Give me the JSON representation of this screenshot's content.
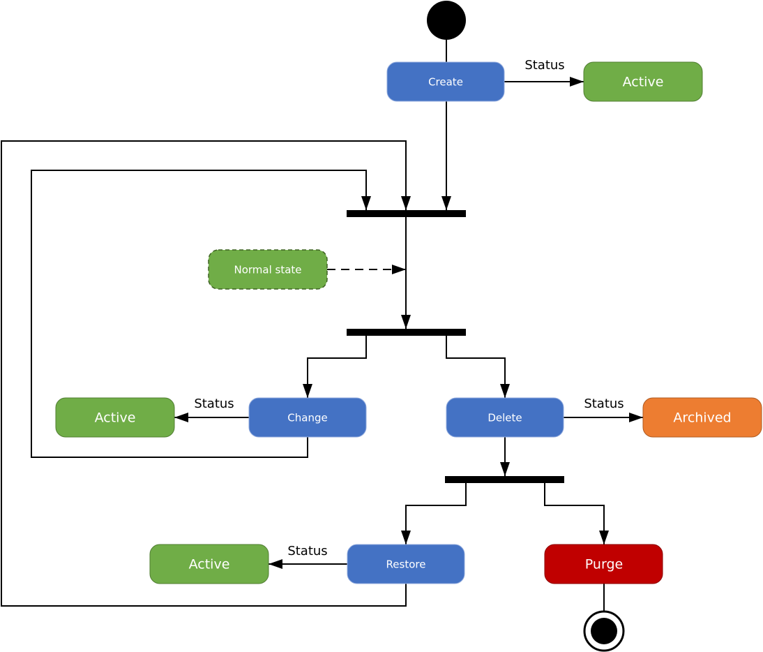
{
  "colors": {
    "action": "#4472C4",
    "active": "#70AD47",
    "archived": "#ED7D31",
    "purge": "#C00000",
    "line": "#000000"
  },
  "nodes": {
    "create": "Create",
    "active_create": "Active",
    "normal_state": "Normal state",
    "change": "Change",
    "active_change": "Active",
    "delete": "Delete",
    "archived": "Archived",
    "restore": "Restore",
    "active_restore": "Active",
    "purge": "Purge"
  },
  "edge_labels": {
    "create_status": "Status",
    "change_status": "Status",
    "delete_status": "Status",
    "restore_status": "Status"
  }
}
